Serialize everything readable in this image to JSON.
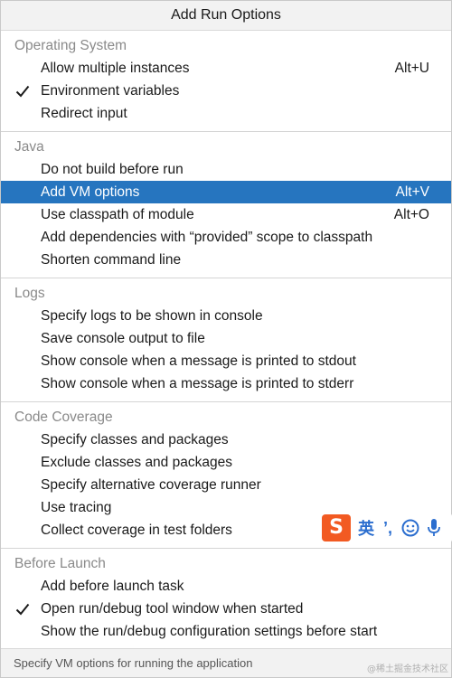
{
  "popup": {
    "title": "Add Run Options"
  },
  "groups": [
    {
      "title": "Operating System",
      "items": [
        {
          "label": "Allow multiple instances",
          "shortcut": "Alt+U"
        },
        {
          "label": "Environment variables",
          "checked": true
        },
        {
          "label": "Redirect input"
        }
      ]
    },
    {
      "title": "Java",
      "items": [
        {
          "label": "Do not build before run"
        },
        {
          "label": "Add VM options",
          "shortcut": "Alt+V",
          "selected": true
        },
        {
          "label": "Use classpath of module",
          "shortcut": "Alt+O"
        },
        {
          "label": "Add dependencies with “provided” scope to classpath"
        },
        {
          "label": "Shorten command line"
        }
      ]
    },
    {
      "title": "Logs",
      "items": [
        {
          "label": "Specify logs to be shown in console"
        },
        {
          "label": "Save console output to file"
        },
        {
          "label": "Show console when a message is printed to stdout"
        },
        {
          "label": "Show console when a message is printed to stderr"
        }
      ]
    },
    {
      "title": "Code Coverage",
      "items": [
        {
          "label": "Specify classes and packages"
        },
        {
          "label": "Exclude classes and packages"
        },
        {
          "label": "Specify alternative coverage runner"
        },
        {
          "label": "Use tracing"
        },
        {
          "label": "Collect coverage in test folders"
        }
      ]
    },
    {
      "title": "Before Launch",
      "items": [
        {
          "label": "Add before launch task"
        },
        {
          "label": "Open run/debug tool window when started",
          "checked": true
        },
        {
          "label": "Show the run/debug configuration settings before start"
        }
      ]
    }
  ],
  "footer": {
    "hint": "Specify VM options for running the application"
  },
  "ime": {
    "logo": "S",
    "mode": "英",
    "punct": "’,"
  },
  "watermark": "@稀土掘金技术社区",
  "colors": {
    "selection": "#2675bf",
    "group_title": "#8a8a8a",
    "ime_logo": "#f25a22",
    "ime_accent": "#2b6ecf"
  },
  "icons": {
    "check": "check-icon",
    "smile": "smile-icon",
    "mic": "microphone-icon"
  }
}
